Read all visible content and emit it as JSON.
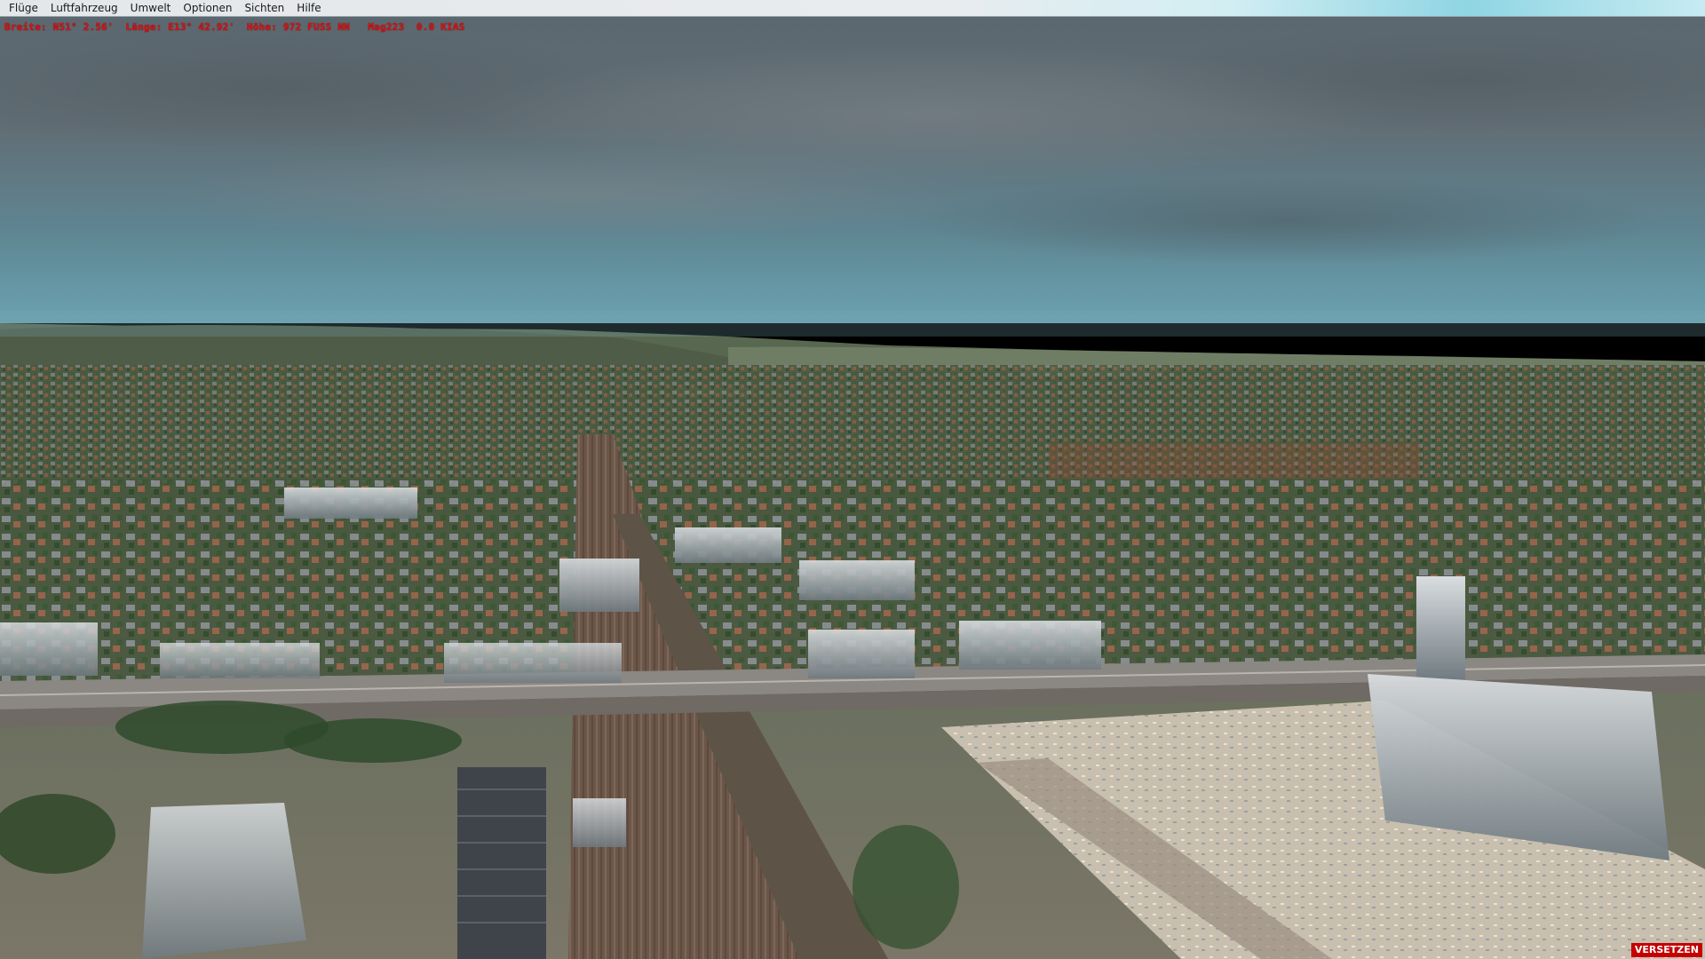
{
  "menu": {
    "items": [
      "Flüge",
      "Luftfahrzeug",
      "Umwelt",
      "Optionen",
      "Sichten",
      "Hilfe"
    ]
  },
  "hud": {
    "readout": "Breite: N51° 2.56'  Länge: E13° 42.92'  Höhe: 972 FUSS NN   Mag223  0.0 KIAS"
  },
  "status": {
    "slew_label": "VERSETZEN"
  },
  "colors": {
    "hud_text": "#e01010",
    "slew_bg": "#c40000",
    "sky_top": "#5f6b72",
    "sky_horizon": "#5f97a6"
  }
}
